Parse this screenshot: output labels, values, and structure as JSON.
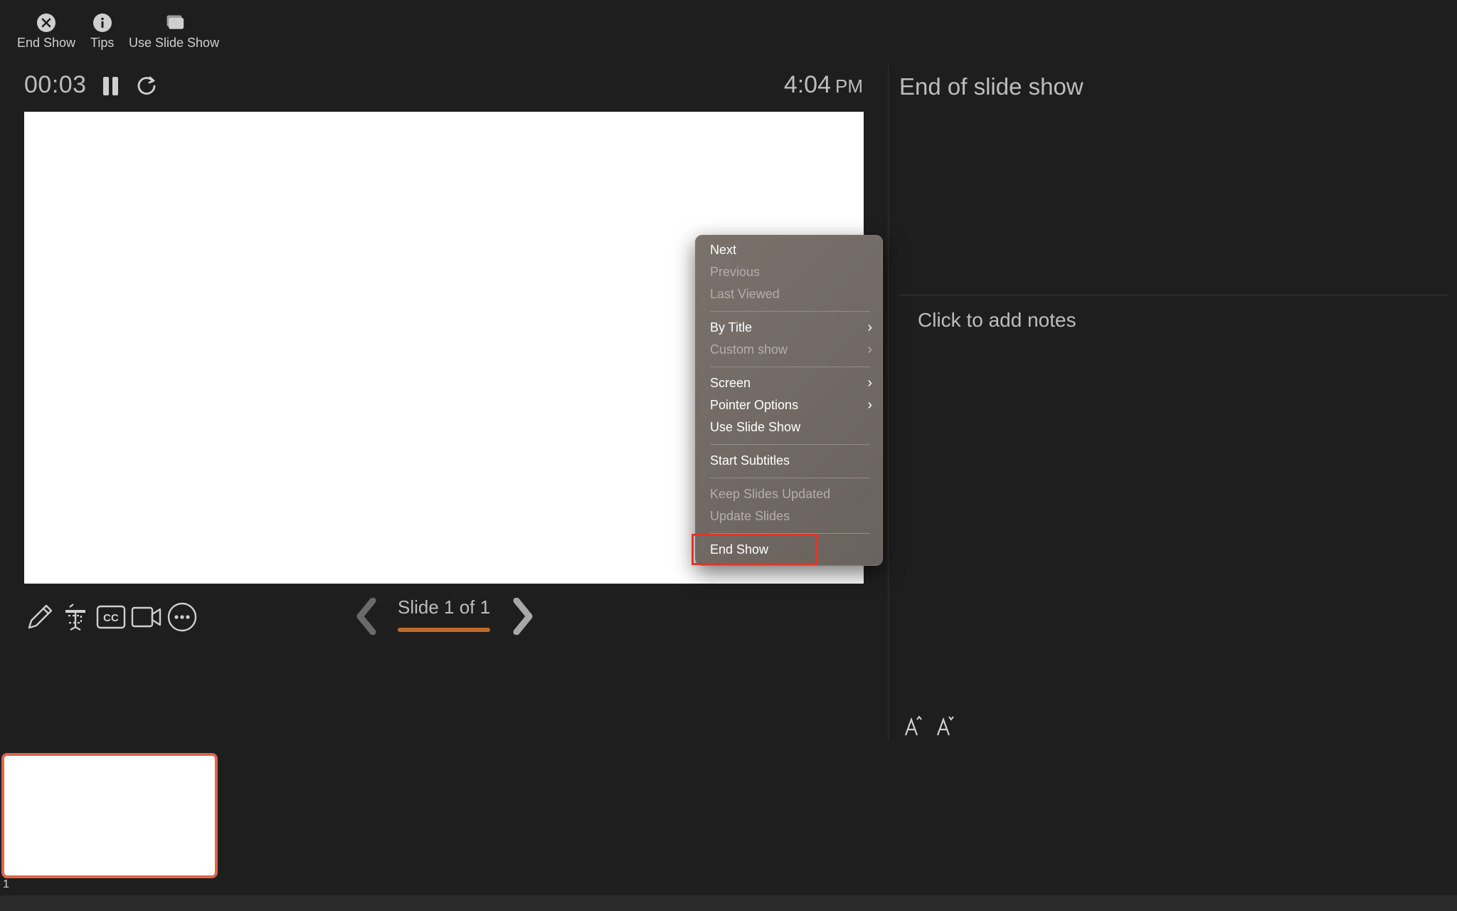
{
  "toolbar": {
    "end_show_label": "End Show",
    "tips_label": "Tips",
    "use_slide_show_label": "Use Slide Show"
  },
  "presenter": {
    "timer": "00:03",
    "clock_time": "4:04",
    "clock_ampm": "PM",
    "slide_counter": "Slide 1 of 1",
    "progress_fraction": 1.0
  },
  "notes": {
    "title": "End of slide show",
    "placeholder": "Click to add notes"
  },
  "thumbnails": [
    {
      "number": "1",
      "selected": true
    }
  ],
  "context_menu": {
    "items": [
      {
        "label": "Next",
        "enabled": true,
        "submenu": false
      },
      {
        "label": "Previous",
        "enabled": false,
        "submenu": false
      },
      {
        "label": "Last Viewed",
        "enabled": false,
        "submenu": false
      },
      {
        "label": "By Title",
        "enabled": true,
        "submenu": true
      },
      {
        "label": "Custom show",
        "enabled": false,
        "submenu": true
      },
      {
        "label": "Screen",
        "enabled": true,
        "submenu": true
      },
      {
        "label": "Pointer Options",
        "enabled": true,
        "submenu": true
      },
      {
        "label": "Use Slide Show",
        "enabled": true,
        "submenu": false
      },
      {
        "label": "Start Subtitles",
        "enabled": true,
        "submenu": false
      },
      {
        "label": "Keep Slides Updated",
        "enabled": false,
        "submenu": false
      },
      {
        "label": "Update Slides",
        "enabled": false,
        "submenu": false
      },
      {
        "label": "End Show",
        "enabled": true,
        "submenu": false,
        "highlighted": true
      }
    ],
    "chevron": "›"
  },
  "icons": {
    "close": "close-circle-icon",
    "info": "info-circle-icon",
    "slideshow": "stacked-slides-icon",
    "pause": "pause-icon",
    "reset": "reset-timer-icon",
    "pen": "pen-icon",
    "laser": "laser-pointer-icon",
    "cc": "closed-captions-icon",
    "camera": "camera-icon",
    "more": "more-options-icon",
    "increase_font": "increase-font-icon",
    "decrease_font": "decrease-font-icon"
  },
  "colors": {
    "background": "#1e1e1e",
    "accent": "#c0692a",
    "selection": "#e0634d",
    "highlight_box": "#e53423"
  }
}
